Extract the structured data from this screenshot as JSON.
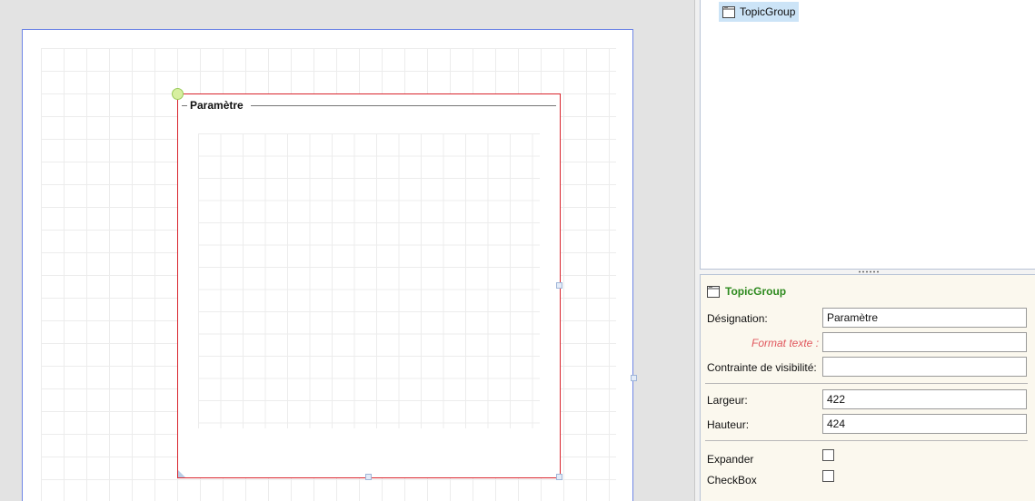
{
  "designer": {
    "group_title": "Paramètre"
  },
  "tree": {
    "items": [
      {
        "label": "TopicGroup",
        "icon": "window-icon",
        "selected": true
      }
    ]
  },
  "properties": {
    "title": "TopicGroup",
    "icon": "window-icon",
    "title_color": "#2d8a1e",
    "fields": {
      "designation": {
        "label": "Désignation:",
        "value": "Paramètre"
      },
      "format_texte": {
        "label": "Format texte :",
        "value": ""
      },
      "contrainte": {
        "label": "Contrainte de visibilité:",
        "value": ""
      },
      "largeur": {
        "label": "Largeur:",
        "value": "422"
      },
      "hauteur": {
        "label": "Hauteur:",
        "value": "424"
      }
    },
    "checkboxes": {
      "expander": {
        "label": "Expander",
        "checked": false
      },
      "checkbox": {
        "label": "CheckBox",
        "checked": false
      }
    }
  },
  "colors": {
    "selection_border": "#d9242c",
    "page_border": "#6f86e6",
    "tree_selection": "#cce4f7",
    "props_background": "#fbf8ee"
  }
}
